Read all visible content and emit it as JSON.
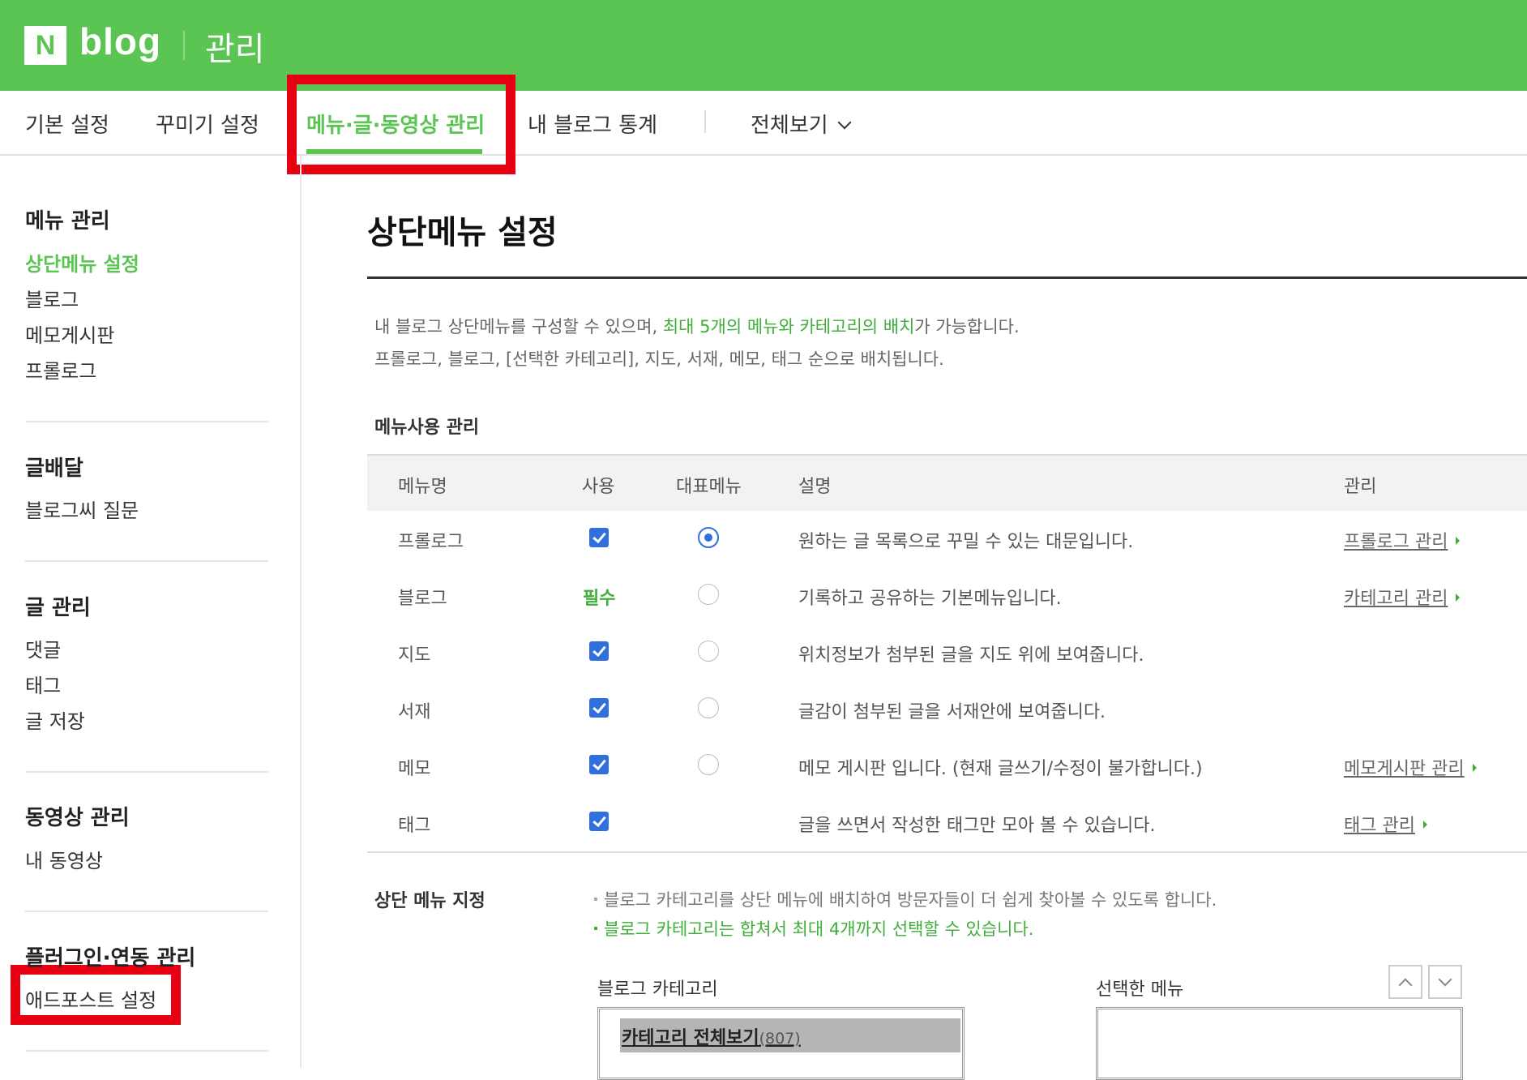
{
  "header": {
    "logo_letter": "N",
    "logo_word": "blog",
    "title": "관리"
  },
  "topnav": {
    "items": [
      "기본 설정",
      "꾸미기 설정",
      "메뉴·글·동영상 관리",
      "내 블로그 통계"
    ],
    "view_all": "전체보기"
  },
  "sidebar": {
    "sections": [
      {
        "title": "메뉴 관리",
        "items": [
          "상단메뉴 설정",
          "블로그",
          "메모게시판",
          "프롤로그"
        ]
      },
      {
        "title": "글배달",
        "items": [
          "블로그씨 질문"
        ]
      },
      {
        "title": "글 관리",
        "items": [
          "댓글",
          "태그",
          "글 저장"
        ]
      },
      {
        "title": "동영상 관리",
        "items": [
          "내 동영상"
        ]
      },
      {
        "title": "플러그인·연동 관리",
        "items": [
          "애드포스트 설정"
        ]
      }
    ]
  },
  "main": {
    "title": "상단메뉴 설정",
    "desc1_pre": "내 블로그 상단메뉴를 구성할 수 있으며, ",
    "desc1_hl": "최대 5개의 메뉴와 카테고리의 배치",
    "desc1_post": "가 가능합니다.",
    "desc2": "프롤로그, 블로그, [선택한 카테고리], 지도, 서재, 메모, 태그 순으로 배치됩니다.",
    "usage_title": "메뉴사용 관리",
    "columns": [
      "메뉴명",
      "사용",
      "대표메뉴",
      "설명",
      "관리"
    ],
    "rows": [
      {
        "name": "프롤로그",
        "use": "checked",
        "rep": true,
        "desc": "원하는 글 목록으로 꾸밀 수 있는 대문입니다.",
        "manage": "프롤로그 관리"
      },
      {
        "name": "블로그",
        "use": "필수",
        "rep": false,
        "desc": "기록하고 공유하는 기본메뉴입니다.",
        "manage": "카테고리 관리"
      },
      {
        "name": "지도",
        "use": "checked",
        "rep": false,
        "desc": "위치정보가 첨부된 글을 지도 위에 보여줍니다.",
        "manage": ""
      },
      {
        "name": "서재",
        "use": "checked",
        "rep": false,
        "desc": "글감이 첨부된 글을 서재안에 보여줍니다.",
        "manage": ""
      },
      {
        "name": "메모",
        "use": "checked",
        "rep": false,
        "desc": "메모 게시판 입니다. (현재 글쓰기/수정이 불가합니다.)",
        "manage": "메모게시판 관리"
      },
      {
        "name": "태그",
        "use": "checked",
        "rep": false,
        "desc": "글을 쓰면서 작성한 태그만 모아 볼 수 있습니다.",
        "manage": "태그 관리"
      }
    ],
    "top_menu_title": "상단 메뉴 지정",
    "note1": "블로그 카테고리를 상단 메뉴에 배치하여 방문자들이 더 쉽게 찾아볼 수 있도록 합니다.",
    "note2": "블로그 카테고리는 합쳐서 최대 4개까지 선택할 수 있습니다.",
    "category_label": "블로그 카테고리",
    "selected_label": "선택한 메뉴",
    "category_item": "카테고리 전체보기",
    "category_count": "(807)"
  },
  "colors": {
    "brand_green": "#5ac552",
    "highlight_red": "#e60012",
    "check_blue": "#2f6fde"
  }
}
